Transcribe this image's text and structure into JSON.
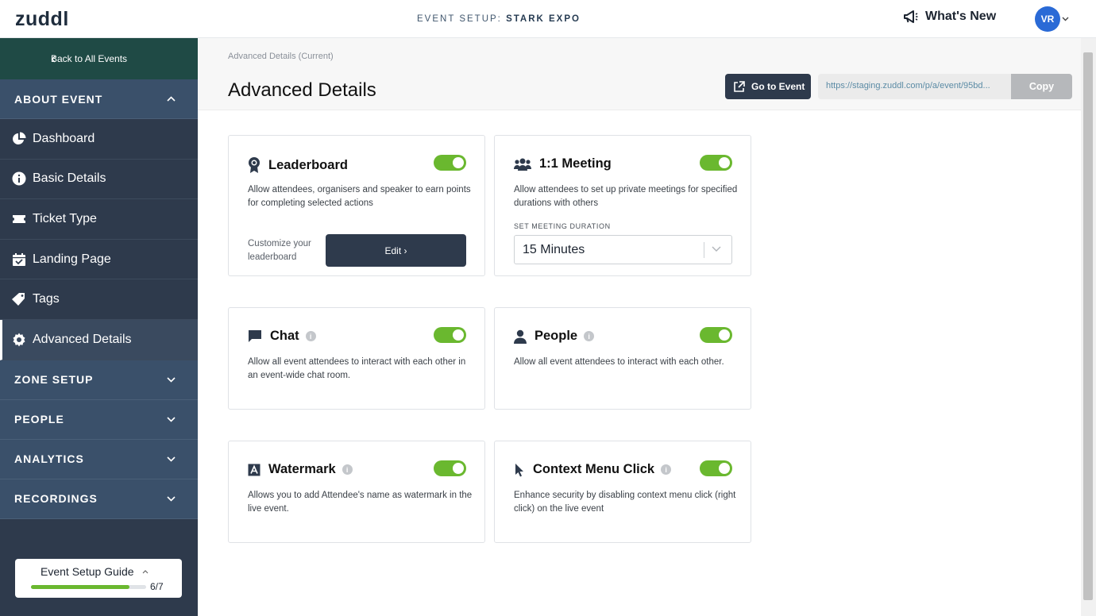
{
  "app": {
    "logo": "zuddl"
  },
  "topbar": {
    "event_prefix": "EVENT SETUP: ",
    "event_name": "STARK EXPO",
    "whats_new": "What's New",
    "avatar_initials": "VR"
  },
  "sidebar": {
    "back_label": "Back to All Events",
    "sections": {
      "about_event": "ABOUT EVENT",
      "zone_setup": "ZONE SETUP",
      "people": "PEOPLE",
      "analytics": "ANALYTICS",
      "recordings": "RECORDINGS"
    },
    "items": [
      {
        "label": "Dashboard",
        "icon": "pie-chart-icon"
      },
      {
        "label": "Basic Details",
        "icon": "info-icon"
      },
      {
        "label": "Ticket Type",
        "icon": "ticket-icon"
      },
      {
        "label": "Landing Page",
        "icon": "calendar-icon"
      },
      {
        "label": "Tags",
        "icon": "tag-icon"
      },
      {
        "label": "Advanced Details",
        "icon": "gear-icon",
        "active": true
      }
    ],
    "guide": {
      "title": "Event Setup Guide",
      "count": "6/7",
      "progress": 0.857
    }
  },
  "header": {
    "breadcrumb": "Advanced Details (Current)",
    "title": "Advanced Details",
    "goto_label": "Go to Event",
    "url": "https://staging.zuddl.com/p/a/event/95bd...",
    "copy_label": "Copy"
  },
  "cards": {
    "leaderboard": {
      "title": "Leaderboard",
      "enabled": true,
      "desc": "Allow attendees, organisers and speaker to earn points for completing selected actions",
      "customize": "Customize your leaderboard",
      "edit_label": "Edit ›"
    },
    "meeting": {
      "title": "1:1 Meeting",
      "enabled": true,
      "desc": "Allow attendees to set up private meetings for specified durations with others",
      "duration_label": "SET MEETING DURATION",
      "duration_value": "15 Minutes"
    },
    "chat": {
      "title": "Chat",
      "enabled": true,
      "desc": "Allow all event attendees to interact with each other in an event-wide chat room."
    },
    "people": {
      "title": "People",
      "enabled": true,
      "desc": "Allow all event attendees to interact with each other."
    },
    "watermark": {
      "title": "Watermark",
      "enabled": true,
      "desc": "Allows you to add Attendee's name as watermark in the live event."
    },
    "context_menu": {
      "title": "Context Menu Click",
      "enabled": true,
      "desc": "Enhance security by disabling context menu click (right click) on the live event"
    }
  },
  "colors": {
    "sidebar_bg": "#2e3a4c",
    "back_bg": "#1f4a45",
    "accent_green": "#6ab82f",
    "avatar_blue": "#2a6ad6"
  }
}
